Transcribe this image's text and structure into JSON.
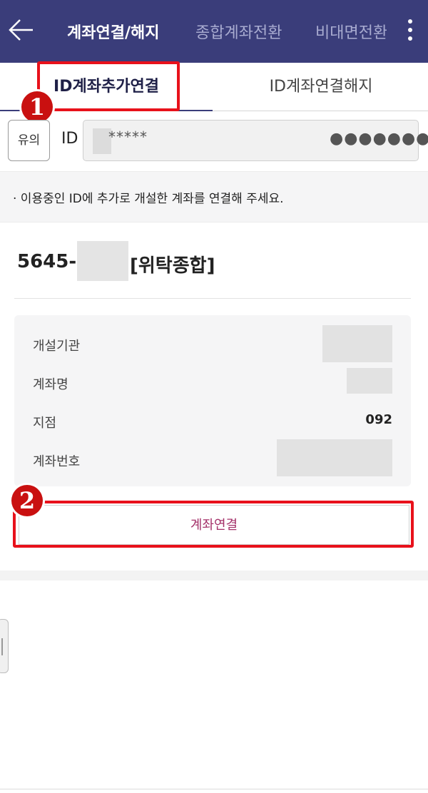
{
  "header": {
    "tabs": [
      "계좌연결/해지",
      "종합계좌전환",
      "비대면전환"
    ]
  },
  "subtabs": [
    "ID계좌추가연결",
    "ID계좌연결해지"
  ],
  "markers": [
    "1",
    "2"
  ],
  "id_row": {
    "notice_label": "유의",
    "id_label": "ID",
    "id_value": "*****",
    "password_dots": "●●●●●●●"
  },
  "info": "· 이용중인 ID에 추가로 개설한 계좌를 연결해 주세요.",
  "account": {
    "number_prefix": "5645-",
    "type": "[위탁종합]",
    "details": [
      {
        "label": "개설기관",
        "value": ""
      },
      {
        "label": "계좌명",
        "value": ""
      },
      {
        "label": "지점",
        "value": "092"
      },
      {
        "label": "계좌번호",
        "value": ""
      }
    ]
  },
  "buttons": {
    "connect": "계좌연결"
  },
  "icons": [
    "back-arrow-icon",
    "more-vertical-icon"
  ],
  "colors": {
    "header_bg": "#3a3d7a",
    "highlight_red": "#e8111b",
    "connect_text": "#a4326a"
  }
}
